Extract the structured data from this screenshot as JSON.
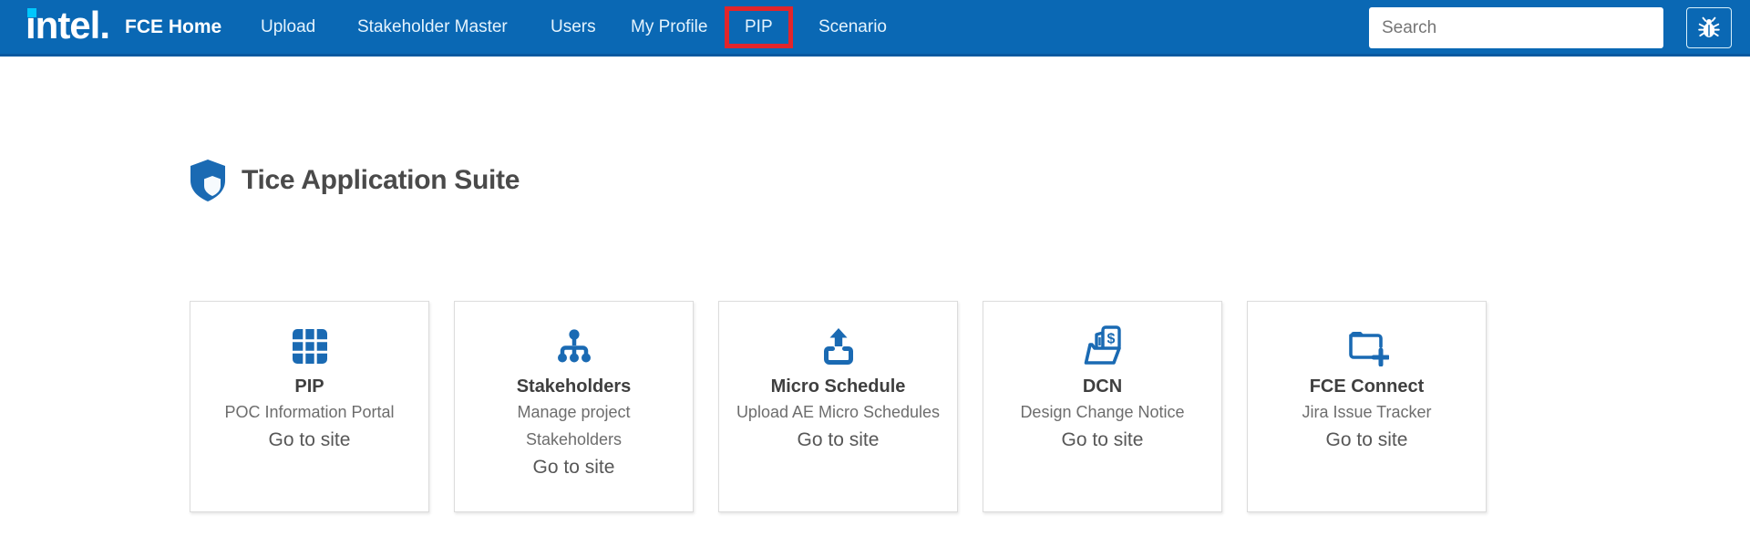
{
  "navbar": {
    "logo": {
      "text": "intel."
    },
    "home_label": "FCE Home",
    "items": [
      {
        "label": "Upload"
      },
      {
        "label": "Stakeholder Master"
      },
      {
        "label": "Users"
      },
      {
        "label": "My Profile"
      },
      {
        "label": "PIP",
        "highlighted": true
      },
      {
        "label": "Scenario"
      }
    ],
    "search": {
      "placeholder": "Search",
      "value": ""
    },
    "debug_button": {
      "icon": "bug-icon"
    }
  },
  "main": {
    "suite_header": {
      "icon": "shield-icon",
      "title": "Tice Application Suite"
    },
    "cards": [
      {
        "icon": "table-grid-icon",
        "title": "PIP",
        "desc_lines": [
          "POC Information Portal"
        ],
        "link_label": "Go to site"
      },
      {
        "icon": "org-chart-icon",
        "title": "Stakeholders",
        "desc_lines": [
          "Manage project",
          "Stakeholders"
        ],
        "link_label": "Go to site"
      },
      {
        "icon": "upload-icon",
        "title": "Micro Schedule",
        "desc_lines": [
          "Upload AE Micro Schedules"
        ],
        "link_label": "Go to site"
      },
      {
        "icon": "dollar-document-folder-icon",
        "title": "DCN",
        "desc_lines": [
          "Design Change Notice"
        ],
        "link_label": "Go to site"
      },
      {
        "icon": "folder-plus-icon",
        "title": "FCE Connect",
        "desc_lines": [
          "Jira Issue Tracker"
        ],
        "link_label": "Go to site"
      }
    ]
  },
  "colors": {
    "navbar_blue": "#0a68b4",
    "navbar_border_blue": "#0859a0",
    "intel_dot_cyan": "#00c7fd",
    "nav_link_text": "#e4f3fd",
    "highlight_red": "#e2252b",
    "icon_blue": "#1a6ab3",
    "heading_text": "#4a4a4a",
    "card_border": "#dcdcdc",
    "card_title_text": "#3f3f3f",
    "card_desc_text": "#6d6d6d",
    "card_link_text": "#575757",
    "search_placeholder": "#757575"
  }
}
